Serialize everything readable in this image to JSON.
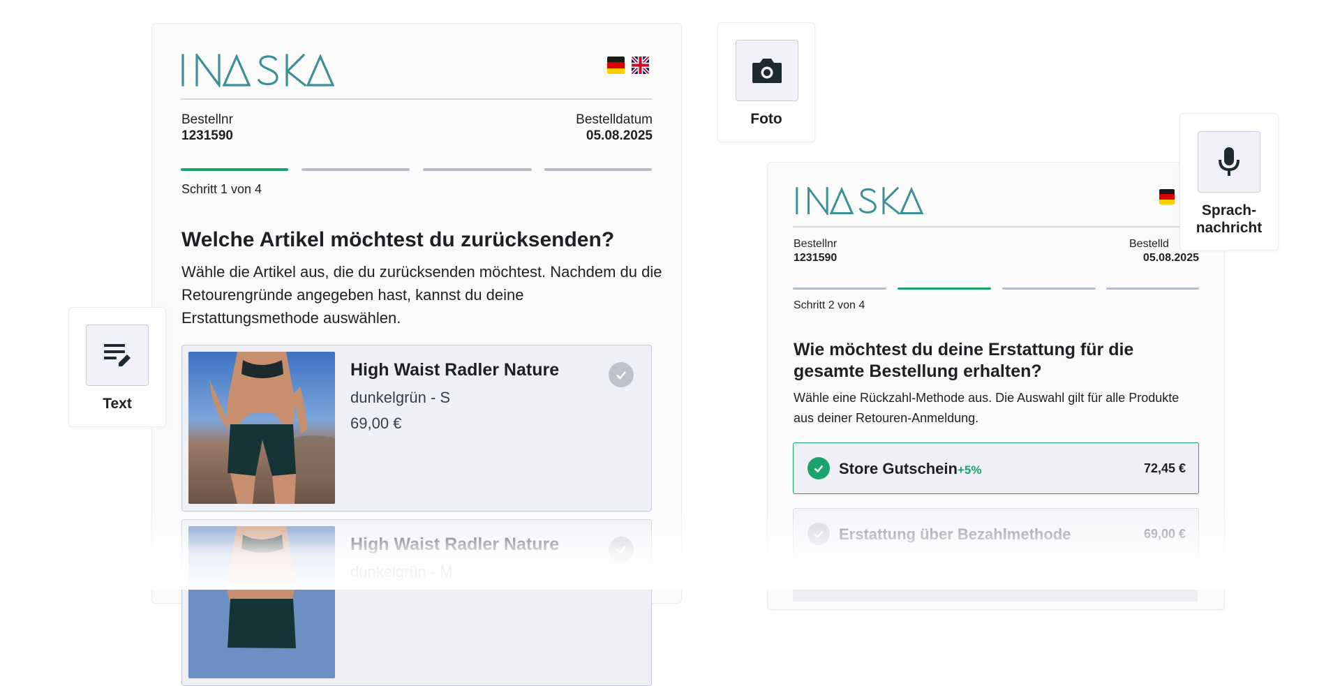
{
  "brand": {
    "name": "INASKA",
    "accent": "#3b8f96",
    "success": "#1aa36b"
  },
  "languages": [
    "de",
    "en"
  ],
  "panel1": {
    "order_label": "Bestellnr",
    "order_number": "1231590",
    "date_label": "Bestelldatum",
    "date_value": "05.08.2025",
    "step_text": "Schritt 1 von 4",
    "progress": {
      "current": 1,
      "total": 4
    },
    "title": "Welche Artikel möchtest du zurücksenden?",
    "description": "Wähle die Artikel aus, die du zurücksenden möchtest. Nachdem du die Retourengründe angegeben hast, kannst du deine Erstattungsmethode auswählen.",
    "items": [
      {
        "name": "High Waist Radler Nature",
        "variant": "dunkelgrün - S",
        "price": "69,00 €"
      },
      {
        "name": "High Waist Radler Nature",
        "variant": "dunkelgrün - M"
      }
    ]
  },
  "panel2": {
    "order_label": "Bestellnr",
    "order_number": "1231590",
    "date_label": "Bestelld",
    "date_value": "05.08.2025",
    "step_text": "Schritt 2 von 4",
    "progress": {
      "current": 2,
      "total": 4
    },
    "title": "Wie möchtest du deine Erstattung für die gesamte Bestellung erhalten?",
    "description": "Wähle eine Rückzahl-Methode aus. Die Auswahl gilt für alle Produkte aus deiner Retouren-Anmeldung.",
    "options": [
      {
        "label": "Store Gutschein",
        "bonus": "+5%",
        "amount": "72,45 €",
        "selected": true
      },
      {
        "label": "Erstattung über Bezahlmethode",
        "amount": "69,00 €",
        "selected": false
      }
    ]
  },
  "tools": {
    "text": {
      "label": "Text",
      "icon": "text-edit-icon"
    },
    "photo": {
      "label": "Foto",
      "icon": "camera-icon"
    },
    "voice": {
      "label": "Sprach-\nnachricht",
      "icon": "microphone-icon"
    }
  }
}
